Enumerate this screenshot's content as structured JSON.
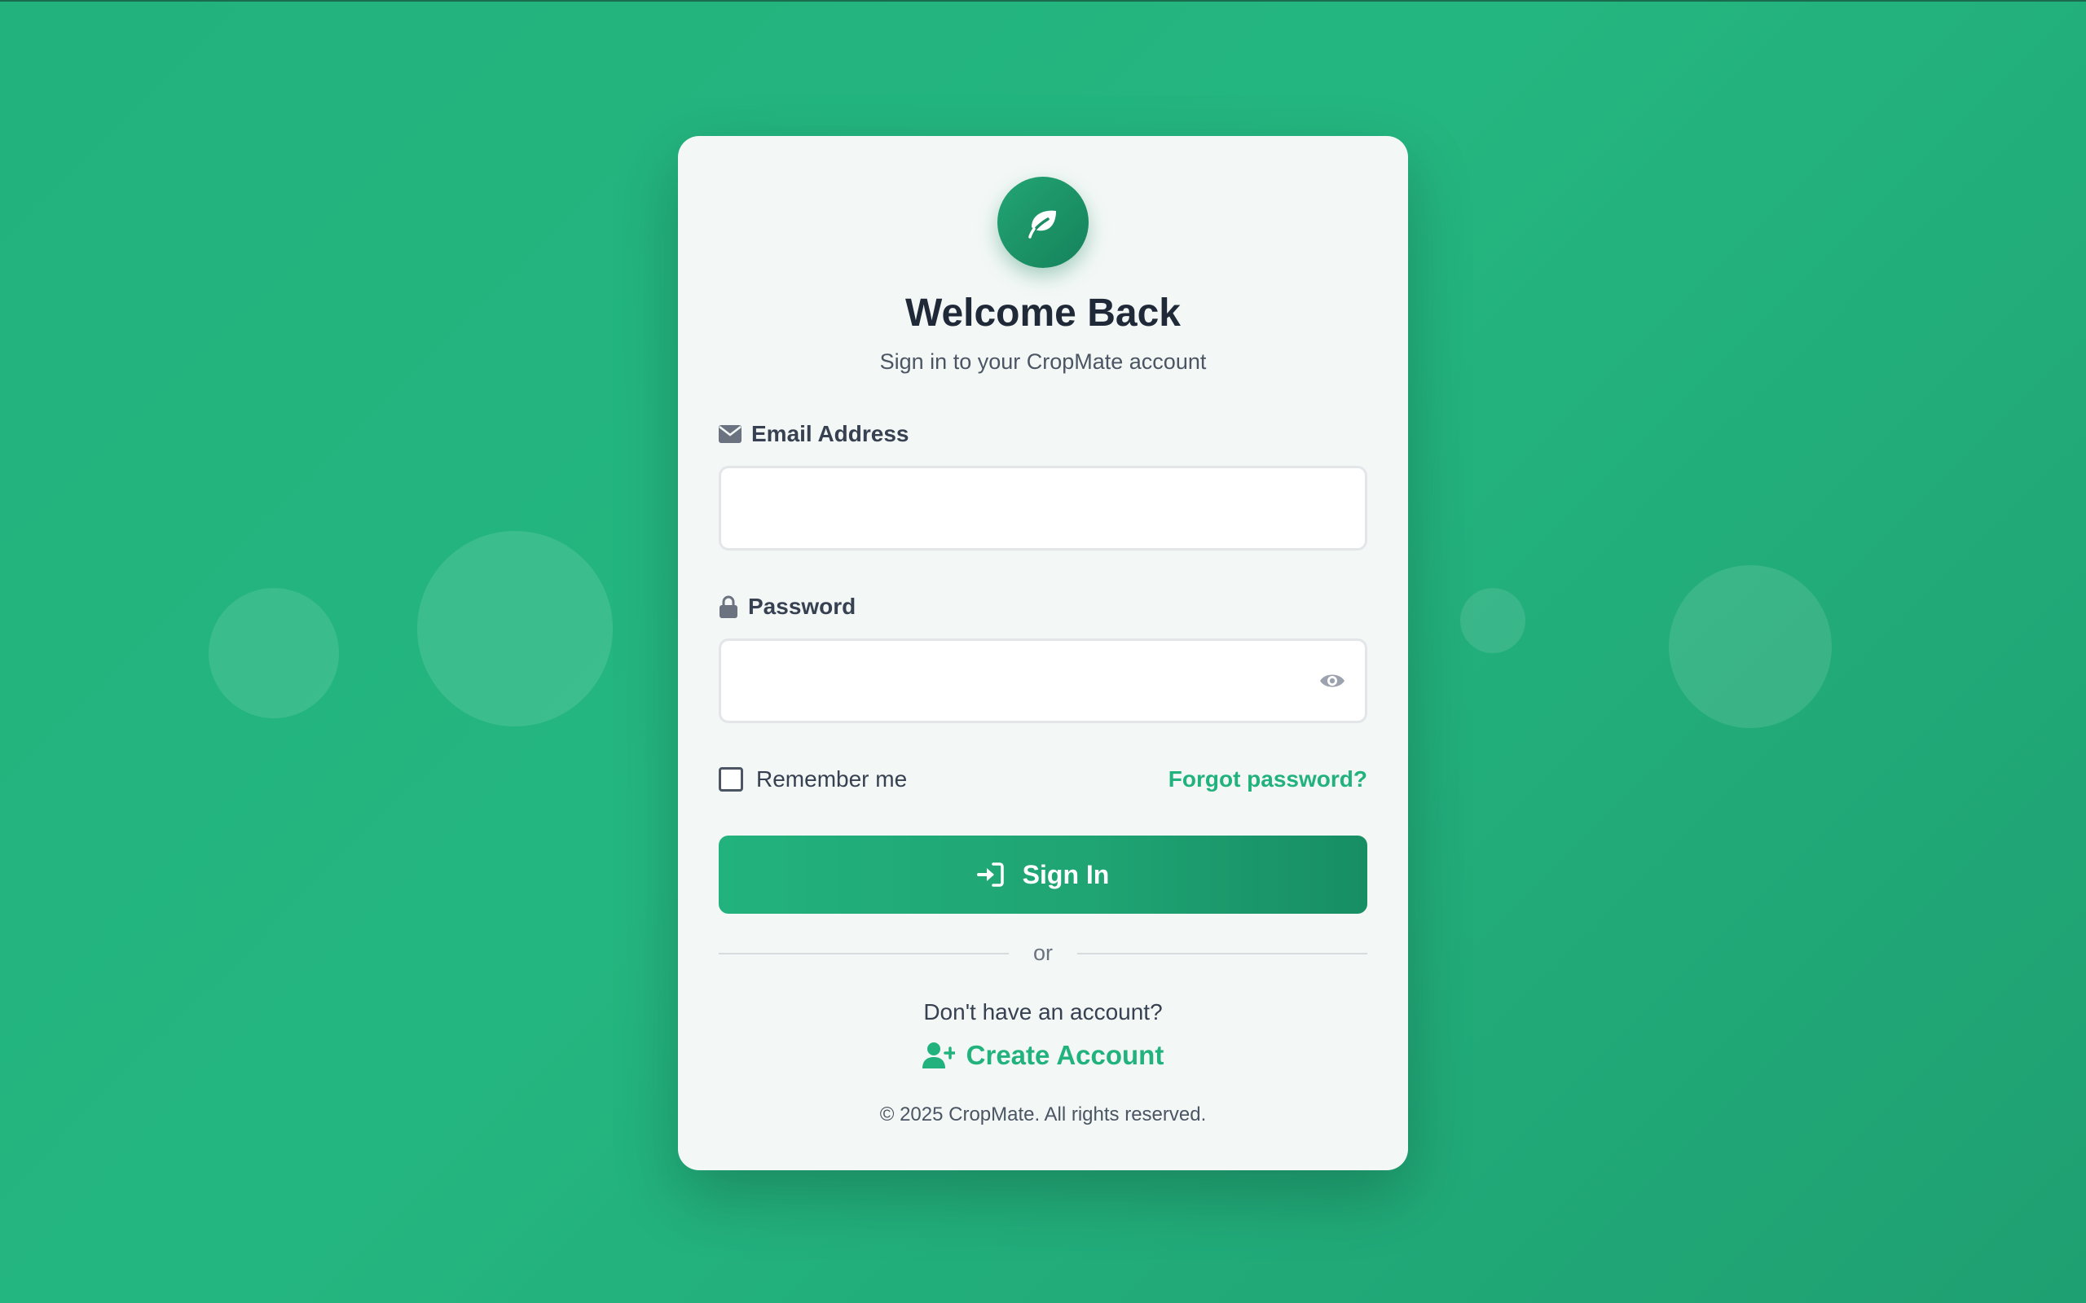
{
  "brand": {
    "logo_icon": "leaf-icon",
    "accent_color": "#22b27d"
  },
  "header": {
    "title": "Welcome Back",
    "subtitle": "Sign in to your CropMate account"
  },
  "form": {
    "email": {
      "icon": "envelope-icon",
      "label": "Email Address",
      "value": "",
      "placeholder": ""
    },
    "password": {
      "icon": "lock-icon",
      "label": "Password",
      "value": "",
      "placeholder": "",
      "toggle_icon": "eye-icon"
    },
    "remember_label": "Remember me",
    "remember_checked": false,
    "forgot_label": "Forgot password?",
    "submit_icon": "sign-in-icon",
    "submit_label": "Sign In"
  },
  "divider_text": "or",
  "signup": {
    "prompt": "Don't have an account?",
    "icon": "user-plus-icon",
    "link_label": "Create Account"
  },
  "footer": {
    "copyright": "© 2025 CropMate. All rights reserved."
  }
}
